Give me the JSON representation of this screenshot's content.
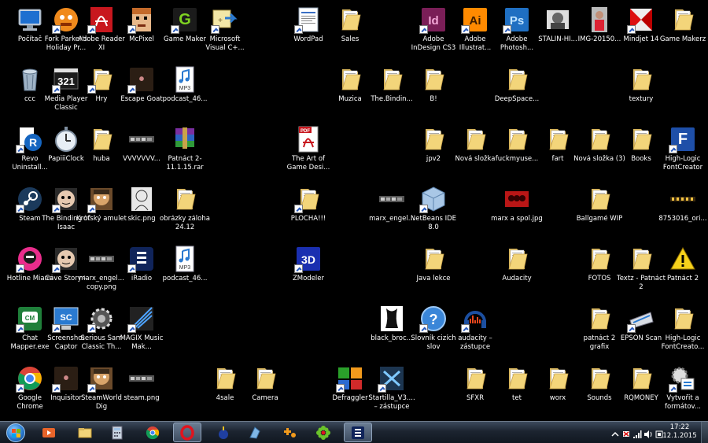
{
  "desktop": {
    "icons": [
      {
        "label": "Počítač",
        "icon": "computer-icon",
        "col": 0,
        "row": 0,
        "kind": "computer",
        "shortcut": false
      },
      {
        "label": "Fork Parker's Holiday Pr...",
        "icon": "game-icon",
        "col": 1,
        "row": 0,
        "kind": "orange",
        "shortcut": true
      },
      {
        "label": "Adobe Reader XI",
        "icon": "adobe-reader-icon",
        "col": 2,
        "row": 0,
        "kind": "reader",
        "shortcut": true
      },
      {
        "label": "McPixel",
        "icon": "mcpixel-icon",
        "col": 3,
        "row": 0,
        "kind": "face",
        "shortcut": true
      },
      {
        "label": "Game Maker",
        "icon": "game-maker-icon",
        "col": 4,
        "row": 0,
        "kind": "gm",
        "shortcut": true
      },
      {
        "label": "Microsoft Visual C+...",
        "icon": "visual-c-icon",
        "col": 5,
        "row": 0,
        "kind": "vc",
        "shortcut": true
      },
      {
        "label": "WordPad",
        "icon": "wordpad-icon",
        "col": 7,
        "row": 0,
        "kind": "doc",
        "shortcut": true
      },
      {
        "label": "Sales",
        "icon": "folder-icon",
        "col": 8,
        "row": 0,
        "kind": "folder",
        "shortcut": false
      },
      {
        "label": "Adobe InDesign CS3",
        "icon": "indesign-icon",
        "col": 10,
        "row": 0,
        "kind": "id",
        "shortcut": true
      },
      {
        "label": "Adobe Illustrat...",
        "icon": "illustrator-icon",
        "col": 11,
        "row": 0,
        "kind": "ai",
        "shortcut": true
      },
      {
        "label": "Adobe Photosh...",
        "icon": "photoshop-icon",
        "col": 12,
        "row": 0,
        "kind": "ps",
        "shortcut": true
      },
      {
        "label": "STALIN-HI...",
        "icon": "image-icon",
        "col": 13,
        "row": 0,
        "kind": "photo",
        "shortcut": false
      },
      {
        "label": "IMG-20150...",
        "icon": "image-icon",
        "col": 14,
        "row": 0,
        "kind": "photo2",
        "shortcut": false
      },
      {
        "label": "Mindjet 14",
        "icon": "mindjet-icon",
        "col": 15,
        "row": 0,
        "kind": "mindjet",
        "shortcut": true
      },
      {
        "label": "Game Makerz",
        "icon": "folder-icon",
        "col": 16,
        "row": 0,
        "kind": "folder",
        "shortcut": false
      },
      {
        "label": "ccc",
        "icon": "recycle-bin-icon",
        "col": 0,
        "row": 1,
        "kind": "bin",
        "shortcut": false
      },
      {
        "label": "Media Player Classic",
        "icon": "media-player-icon",
        "col": 1,
        "row": 1,
        "kind": "mpc",
        "shortcut": true
      },
      {
        "label": "Hry",
        "icon": "folder-icon",
        "col": 2,
        "row": 1,
        "kind": "folder",
        "shortcut": true
      },
      {
        "label": "Escape Goat",
        "icon": "escape-goat-icon",
        "col": 3,
        "row": 1,
        "kind": "dark",
        "shortcut": true
      },
      {
        "label": "podcast_46...",
        "icon": "mp3-icon",
        "col": 4,
        "row": 1,
        "kind": "mp3",
        "shortcut": false
      },
      {
        "label": "Muzica",
        "icon": "folder-icon",
        "col": 8,
        "row": 1,
        "kind": "folder",
        "shortcut": false
      },
      {
        "label": "The.Bindin...",
        "icon": "folder-icon",
        "col": 9,
        "row": 1,
        "kind": "folder",
        "shortcut": false
      },
      {
        "label": "B!",
        "icon": "folder-icon",
        "col": 10,
        "row": 1,
        "kind": "folder",
        "shortcut": false
      },
      {
        "label": "DeepSpace...",
        "icon": "folder-icon",
        "col": 12,
        "row": 1,
        "kind": "folder",
        "shortcut": false
      },
      {
        "label": "textury",
        "icon": "folder-icon",
        "col": 15,
        "row": 1,
        "kind": "folder",
        "shortcut": false
      },
      {
        "label": "Revo Uninstall...",
        "icon": "revo-icon",
        "col": 0,
        "row": 2,
        "kind": "revo",
        "shortcut": true
      },
      {
        "label": "PapiiiClock",
        "icon": "clock-icon",
        "col": 1,
        "row": 2,
        "kind": "clock",
        "shortcut": false
      },
      {
        "label": "huba",
        "icon": "folder-icon",
        "col": 2,
        "row": 2,
        "kind": "folder",
        "shortcut": false
      },
      {
        "label": "VVVVVVV...",
        "icon": "game-icon",
        "col": 3,
        "row": 2,
        "kind": "strip",
        "shortcut": false
      },
      {
        "label": "Patnáct 2-11.1.15.rar",
        "icon": "rar-icon",
        "col": 4,
        "row": 2,
        "kind": "rar",
        "shortcut": false
      },
      {
        "label": "The Art of Game Desi...",
        "icon": "pdf-icon",
        "col": 7,
        "row": 2,
        "kind": "pdf",
        "shortcut": false
      },
      {
        "label": "jpv2",
        "icon": "folder-icon",
        "col": 10,
        "row": 2,
        "kind": "folder",
        "shortcut": false
      },
      {
        "label": "Nová složka",
        "icon": "folder-icon",
        "col": 11,
        "row": 2,
        "kind": "folder",
        "shortcut": false
      },
      {
        "label": "fuckmyuse...",
        "icon": "folder-icon",
        "col": 12,
        "row": 2,
        "kind": "folder",
        "shortcut": false
      },
      {
        "label": "fart",
        "icon": "folder-icon",
        "col": 13,
        "row": 2,
        "kind": "folder",
        "shortcut": false
      },
      {
        "label": "Nová složka (3)",
        "icon": "folder-icon",
        "col": 14,
        "row": 2,
        "kind": "folder",
        "shortcut": false
      },
      {
        "label": "Books",
        "icon": "folder-icon",
        "col": 15,
        "row": 2,
        "kind": "folder",
        "shortcut": false
      },
      {
        "label": "High-Logic FontCreator",
        "icon": "fontcreator-icon",
        "col": 16,
        "row": 2,
        "kind": "font",
        "shortcut": true
      },
      {
        "label": "Steam",
        "icon": "steam-icon",
        "col": 0,
        "row": 3,
        "kind": "steam",
        "shortcut": true
      },
      {
        "label": "The Binding of Isaac",
        "icon": "isaac-icon",
        "col": 1,
        "row": 3,
        "kind": "face2",
        "shortcut": true
      },
      {
        "label": "Krótský amulet",
        "icon": "face-icon",
        "col": 2,
        "row": 3,
        "kind": "face3",
        "shortcut": true
      },
      {
        "label": "skic.png",
        "icon": "image-icon",
        "col": 3,
        "row": 3,
        "kind": "sketch",
        "shortcut": false
      },
      {
        "label": "obrázky záloha 24.12",
        "icon": "folder-icon",
        "col": 4,
        "row": 3,
        "kind": "folder",
        "shortcut": false
      },
      {
        "label": "PLOCHA!!!",
        "icon": "folder-icon",
        "col": 7,
        "row": 3,
        "kind": "folder",
        "shortcut": true
      },
      {
        "label": "marx_engel...",
        "icon": "image-icon",
        "col": 9,
        "row": 3,
        "kind": "strip",
        "shortcut": false
      },
      {
        "label": "NetBeans IDE 8.0",
        "icon": "netbeans-icon",
        "col": 10,
        "row": 3,
        "kind": "cube",
        "shortcut": true
      },
      {
        "label": "marx a spol.jpg",
        "icon": "image-icon",
        "col": 12,
        "row": 3,
        "kind": "redimg",
        "shortcut": false
      },
      {
        "label": "Ballgamé WIP",
        "icon": "folder-icon",
        "col": 14,
        "row": 3,
        "kind": "folder",
        "shortcut": false
      },
      {
        "label": "8753016_ori...",
        "icon": "image-icon",
        "col": 16,
        "row": 3,
        "kind": "strip2",
        "shortcut": false
      },
      {
        "label": "Hotline Miami",
        "icon": "hotline-miami-icon",
        "col": 0,
        "row": 4,
        "kind": "hotline",
        "shortcut": true
      },
      {
        "label": "Cave Story+",
        "icon": "cave-story-icon",
        "col": 1,
        "row": 4,
        "kind": "face2",
        "shortcut": true
      },
      {
        "label": "marx_engel... copy.png",
        "icon": "image-icon",
        "col": 2,
        "row": 4,
        "kind": "strip",
        "shortcut": false
      },
      {
        "label": "iRadio",
        "icon": "iradio-icon",
        "col": 3,
        "row": 4,
        "kind": "iradio",
        "shortcut": true
      },
      {
        "label": "podcast_46...",
        "icon": "mp3-icon",
        "col": 4,
        "row": 4,
        "kind": "mp3",
        "shortcut": false
      },
      {
        "label": "ZModeler",
        "icon": "zmodeler-icon",
        "col": 7,
        "row": 4,
        "kind": "zmod",
        "shortcut": true
      },
      {
        "label": "Java lekce",
        "icon": "folder-icon",
        "col": 10,
        "row": 4,
        "kind": "folder",
        "shortcut": false
      },
      {
        "label": "Audacity",
        "icon": "folder-icon",
        "col": 12,
        "row": 4,
        "kind": "folder",
        "shortcut": false
      },
      {
        "label": "FOTOS",
        "icon": "folder-icon",
        "col": 14,
        "row": 4,
        "kind": "folder",
        "shortcut": false
      },
      {
        "label": "Textz - Patnáct 2",
        "icon": "folder-icon",
        "col": 15,
        "row": 4,
        "kind": "folder",
        "shortcut": false
      },
      {
        "label": "Patnáct 2",
        "icon": "warning-icon",
        "col": 16,
        "row": 4,
        "kind": "warn",
        "shortcut": false
      },
      {
        "label": "Chat Mapper.exe",
        "icon": "chat-mapper-icon",
        "col": 0,
        "row": 5,
        "kind": "cm",
        "shortcut": true
      },
      {
        "label": "Screenshot Captor",
        "icon": "screenshot-captor-icon",
        "col": 1,
        "row": 5,
        "kind": "scap",
        "shortcut": true
      },
      {
        "label": "Serious Sam Classic Th...",
        "icon": "serious-sam-icon",
        "col": 2,
        "row": 5,
        "kind": "gear",
        "shortcut": true
      },
      {
        "label": "MAGIX Music Mak...",
        "icon": "magix-icon",
        "col": 3,
        "row": 5,
        "kind": "magix",
        "shortcut": true
      },
      {
        "label": "black_broc...",
        "icon": "image-icon",
        "col": 9,
        "row": 5,
        "kind": "corset",
        "shortcut": false
      },
      {
        "label": "Slovník cizích slov",
        "icon": "help-icon",
        "col": 10,
        "row": 5,
        "kind": "help",
        "shortcut": true
      },
      {
        "label": "audacity – zástupce",
        "icon": "audacity-icon",
        "col": 11,
        "row": 5,
        "kind": "audacity",
        "shortcut": true
      },
      {
        "label": "patnáct 2 grafix",
        "icon": "folder-icon",
        "col": 14,
        "row": 5,
        "kind": "folder",
        "shortcut": false
      },
      {
        "label": "EPSON Scan",
        "icon": "scanner-icon",
        "col": 15,
        "row": 5,
        "kind": "scan",
        "shortcut": true
      },
      {
        "label": "High-Logic FontCreato...",
        "icon": "folder-icon",
        "col": 16,
        "row": 5,
        "kind": "folder",
        "shortcut": false
      },
      {
        "label": "Google Chrome",
        "icon": "chrome-icon",
        "col": 0,
        "row": 6,
        "kind": "chrome",
        "shortcut": true
      },
      {
        "label": "Inquisitor",
        "icon": "inquisitor-icon",
        "col": 1,
        "row": 6,
        "kind": "dark",
        "shortcut": true
      },
      {
        "label": "SteamWorld Dig",
        "icon": "steamworld-icon",
        "col": 2,
        "row": 6,
        "kind": "face3",
        "shortcut": true
      },
      {
        "label": "steam.png",
        "icon": "image-icon",
        "col": 3,
        "row": 6,
        "kind": "strip",
        "shortcut": false
      },
      {
        "label": "4sale",
        "icon": "folder-icon",
        "col": 5,
        "row": 6,
        "kind": "folder",
        "shortcut": false
      },
      {
        "label": "Camera",
        "icon": "folder-icon",
        "col": 6,
        "row": 6,
        "kind": "folder",
        "shortcut": false
      },
      {
        "label": "Defraggler",
        "icon": "defraggler-icon",
        "col": 8,
        "row": 6,
        "kind": "defrag",
        "shortcut": true
      },
      {
        "label": "Startilla_V3.... – zástupce",
        "icon": "startilla-icon",
        "col": 9,
        "row": 6,
        "kind": "xa",
        "shortcut": true
      },
      {
        "label": "SFXR",
        "icon": "folder-icon",
        "col": 11,
        "row": 6,
        "kind": "folder",
        "shortcut": false
      },
      {
        "label": "tet",
        "icon": "folder-icon",
        "col": 12,
        "row": 6,
        "kind": "folder",
        "shortcut": false
      },
      {
        "label": "worx",
        "icon": "folder-icon",
        "col": 13,
        "row": 6,
        "kind": "folder",
        "shortcut": false
      },
      {
        "label": "Sounds",
        "icon": "folder-icon",
        "col": 14,
        "row": 6,
        "kind": "folder",
        "shortcut": false
      },
      {
        "label": "RQMONEY",
        "icon": "folder-icon",
        "col": 15,
        "row": 6,
        "kind": "folder",
        "shortcut": false
      },
      {
        "label": "Vytvořit a formátov...",
        "icon": "settings-icon",
        "col": 16,
        "row": 6,
        "kind": "settings",
        "shortcut": true
      }
    ]
  },
  "taskbar": {
    "start": {
      "icon": "windows-start-icon"
    },
    "pinned": [
      {
        "icon": "media-center-icon",
        "active": false
      },
      {
        "icon": "explorer-icon",
        "active": false
      },
      {
        "icon": "calculator-icon",
        "active": false
      },
      {
        "icon": "chrome-icon",
        "active": false
      },
      {
        "icon": "opera-icon",
        "active": true
      },
      {
        "icon": "bomberman-icon",
        "active": false
      },
      {
        "icon": "crystal-icon",
        "active": false
      },
      {
        "icon": "joypad-icon",
        "active": false
      },
      {
        "icon": "icq-icon",
        "active": false
      },
      {
        "icon": "iradio-icon",
        "active": true
      }
    ],
    "tray": {
      "icons": [
        "show-hidden-icon",
        "flag-icon",
        "network-icon",
        "volume-icon",
        "action-center-icon"
      ],
      "time": "17:22",
      "date": "12.1.2015"
    }
  }
}
